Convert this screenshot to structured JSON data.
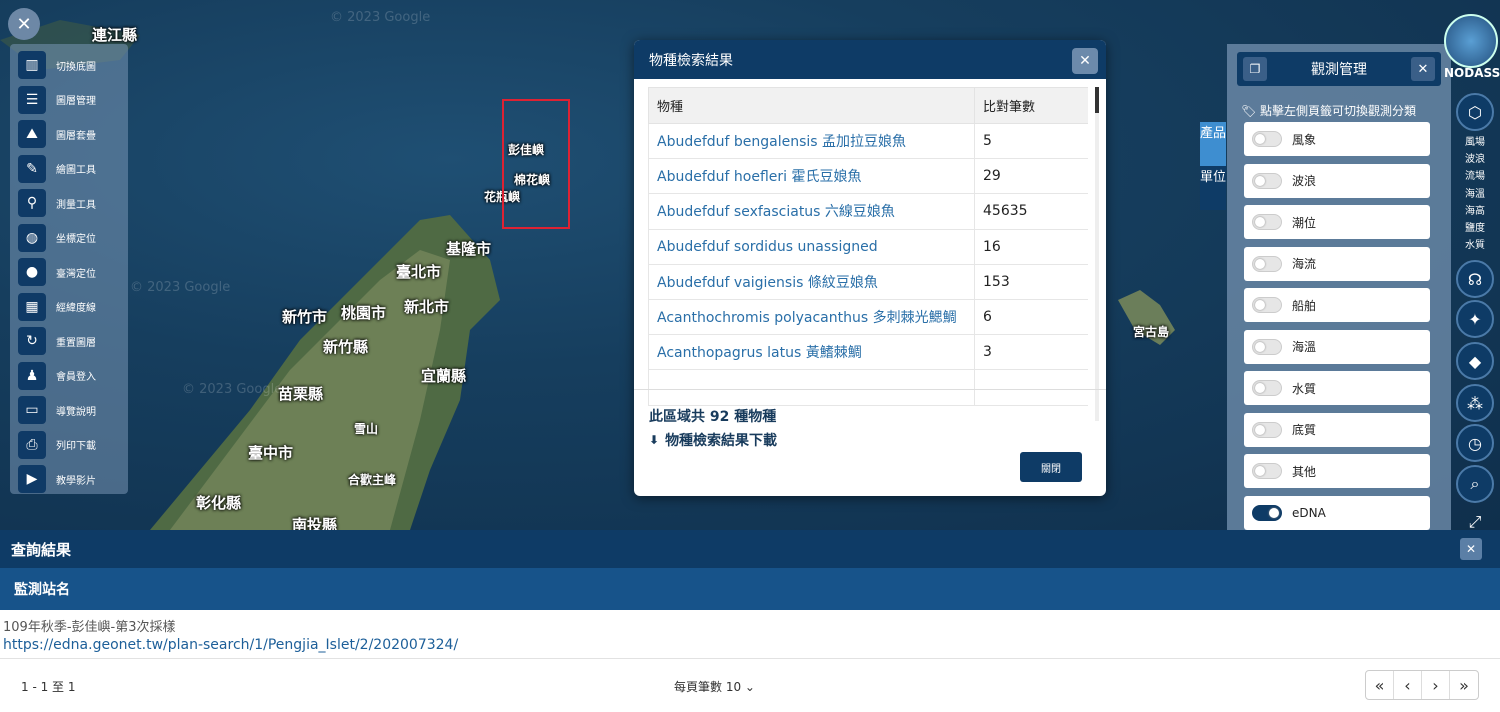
{
  "map": {
    "watermark": "© 2023 Google",
    "labels": {
      "lienchiang": "連江縣",
      "keelung": "基隆市",
      "taipei": "臺北市",
      "new_taipei": "新北市",
      "taoyuan": "桃園市",
      "hsinchu_city": "新竹市",
      "hsinchu_county": "新竹縣",
      "yilan": "宜蘭縣",
      "miaoli": "苗栗縣",
      "taichung": "臺中市",
      "changhua": "彰化縣",
      "nantou": "南投縣",
      "mianhua": "棉花嶼",
      "pengjia": "彭佳嶼",
      "huaping": "花瓶嶼",
      "xueshan": "雪山",
      "hehuan": "合歡主峰",
      "miyako": "宮古島"
    }
  },
  "toolbar": {
    "close_icon": "close-icon",
    "items": [
      {
        "label": "切換底圖",
        "icon": "map-icon",
        "glyph": "▥"
      },
      {
        "label": "圖層管理",
        "icon": "list-icon",
        "glyph": "☰"
      },
      {
        "label": "圖層套疊",
        "icon": "layers-icon",
        "glyph": "⛰"
      },
      {
        "label": "繪圖工具",
        "icon": "brush-icon",
        "glyph": "✎"
      },
      {
        "label": "測量工具",
        "icon": "compass-icon",
        "glyph": "⚲"
      },
      {
        "label": "坐標定位",
        "icon": "globe-icon",
        "glyph": "◍"
      },
      {
        "label": "臺灣定位",
        "icon": "pin-icon",
        "glyph": "●"
      },
      {
        "label": "經緯度線",
        "icon": "grid-icon",
        "glyph": "▦"
      },
      {
        "label": "重置圖層",
        "icon": "reset-icon",
        "glyph": "↻"
      },
      {
        "label": "會員登入",
        "icon": "user-icon",
        "glyph": "♟"
      },
      {
        "label": "導覽說明",
        "icon": "book-icon",
        "glyph": "▭"
      },
      {
        "label": "列印下載",
        "icon": "print-icon",
        "glyph": "⎙"
      },
      {
        "label": "教學影片",
        "icon": "video-icon",
        "glyph": "▶"
      }
    ]
  },
  "dialog": {
    "title": "物種檢索結果",
    "col_species": "物種",
    "col_count": "比對筆數",
    "rows": [
      {
        "name": "Abudefduf bengalensis 孟加拉豆娘魚",
        "count": "5"
      },
      {
        "name": "Abudefduf hoefleri 霍氏豆娘魚",
        "count": "29"
      },
      {
        "name": "Abudefduf sexfasciatus 六線豆娘魚",
        "count": "45635"
      },
      {
        "name": "Abudefduf sordidus unassigned",
        "count": "16"
      },
      {
        "name": "Abudefduf vaigiensis 條紋豆娘魚",
        "count": "153"
      },
      {
        "name": "Acanthochromis polyacanthus 多刺棘光鰓鯛",
        "count": "6"
      },
      {
        "name": "Acanthopagrus latus 黃鰭棘鯛",
        "count": "3"
      },
      {
        "name": "",
        "count": ""
      }
    ],
    "total_text": "此區域共 92 種物種",
    "download_text": "物種檢索結果下載",
    "close_label": "關閉"
  },
  "product_tab": {
    "a": "產品",
    "b": "單位"
  },
  "observation": {
    "title": "觀測管理",
    "hint": "🏷 點擊左側頁籤可切換觀測分類",
    "toggles": [
      {
        "label": "風象",
        "on": false
      },
      {
        "label": "波浪",
        "on": false
      },
      {
        "label": "潮位",
        "on": false
      },
      {
        "label": "海流",
        "on": false
      },
      {
        "label": "船舶",
        "on": false
      },
      {
        "label": "海溫",
        "on": false
      },
      {
        "label": "水質",
        "on": false
      },
      {
        "label": "底質",
        "on": false
      },
      {
        "label": "其他",
        "on": false
      },
      {
        "label": "eDNA",
        "on": true
      }
    ]
  },
  "rail": {
    "logo_text": "NODASS",
    "list": [
      "風場",
      "波浪",
      "流場",
      "海溫",
      "海高",
      "鹽度",
      "水質"
    ]
  },
  "query": {
    "title": "查詢結果",
    "col_header": "監測站名",
    "row_title": "109年秋季-彭佳嶼-第3次採樣",
    "row_link": "https://edna.geonet.tw/plan-search/1/Pengjia_Islet/2/202007324/",
    "range": "1 - 1 至 1",
    "per_page": "每頁筆數 10  ⌄",
    "pager": [
      "«",
      "‹",
      "›",
      "»"
    ]
  }
}
